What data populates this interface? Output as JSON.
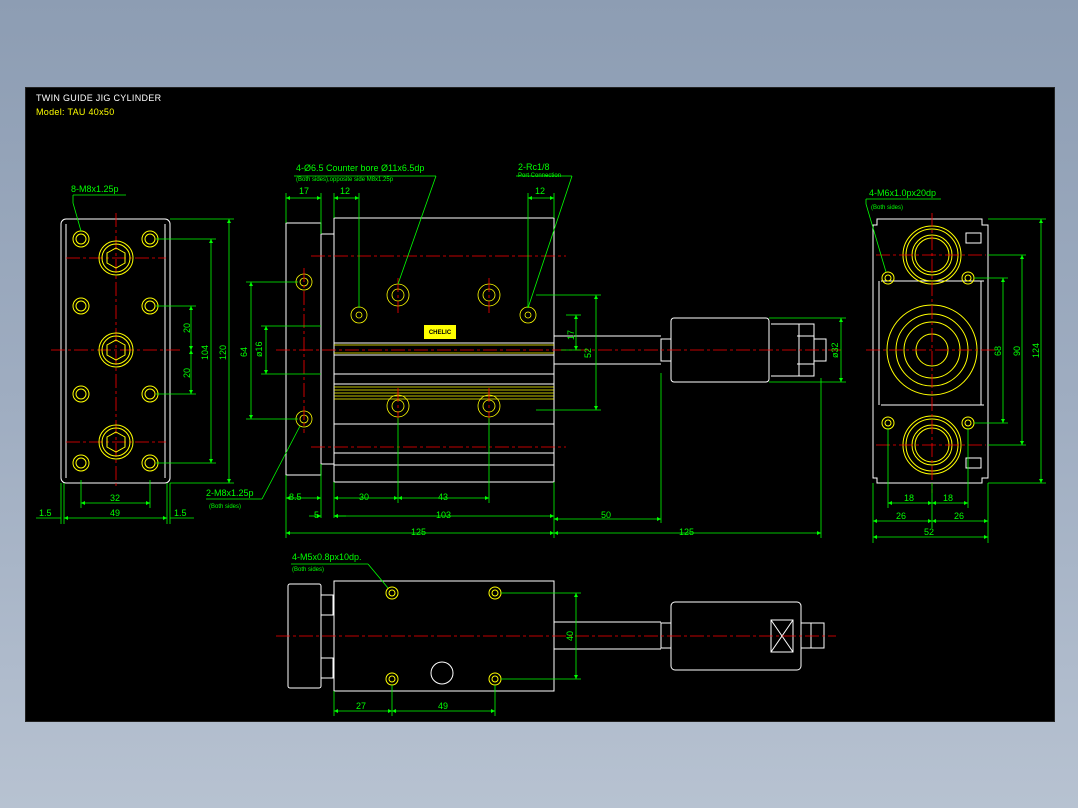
{
  "title": "TWIN GUIDE JIG CYLINDER",
  "model": "Model: TAU 40x50",
  "colors": {
    "background": "#000000",
    "outline": "#ffffff",
    "dimension": "#00ff00",
    "feature": "#ffff00",
    "centerline": "#ff0000",
    "title": "#ffffff",
    "model": "#ffff00"
  },
  "left_view": {
    "callout": "8-M8x1.25p",
    "dims": {
      "d32": "32",
      "d49": "49",
      "d1_5_left": "1.5",
      "d1_5_right": "1.5",
      "d20_top": "20",
      "d20_bot": "20",
      "d104": "104",
      "d120": "120"
    }
  },
  "front_view": {
    "callout_counterbore": "4-Ø6.5  Counter bore Ø11x6.5dp",
    "callout_counterbore_sub": "(Both sides),opposite side M8x1.25p",
    "callout_port": "2-Rc1/8",
    "callout_port_sub": "Port Connection",
    "callout_bottom": "2-M8x1.25p",
    "callout_bottom_sub": "(Both sides)",
    "logo": "CHELIC",
    "dims": {
      "d17": "17",
      "d12_left": "12",
      "d12_right": "12",
      "d64": "64",
      "d16": "ø16",
      "d17_right": "17",
      "d52": "52",
      "d32": "ø32",
      "d8_5": "8.5",
      "d5": "5",
      "d30": "30",
      "d43": "43",
      "d103": "103",
      "d50": "50",
      "d125_a": "125",
      "d125_b": "125"
    }
  },
  "right_view": {
    "callout": "4-M6x1.0px20dp",
    "callout_sub": "(Both sides)",
    "dims": {
      "d68": "68",
      "d90": "90",
      "d124": "124",
      "d18_left": "18",
      "d18_right": "18",
      "d26_left": "26",
      "d26_right": "26",
      "d52": "52"
    }
  },
  "bottom_view": {
    "callout": "4-M5x0.8px10dp.",
    "callout_sub": "(Both sides)",
    "dims": {
      "d40": "40",
      "d27": "27",
      "d49": "49"
    }
  }
}
